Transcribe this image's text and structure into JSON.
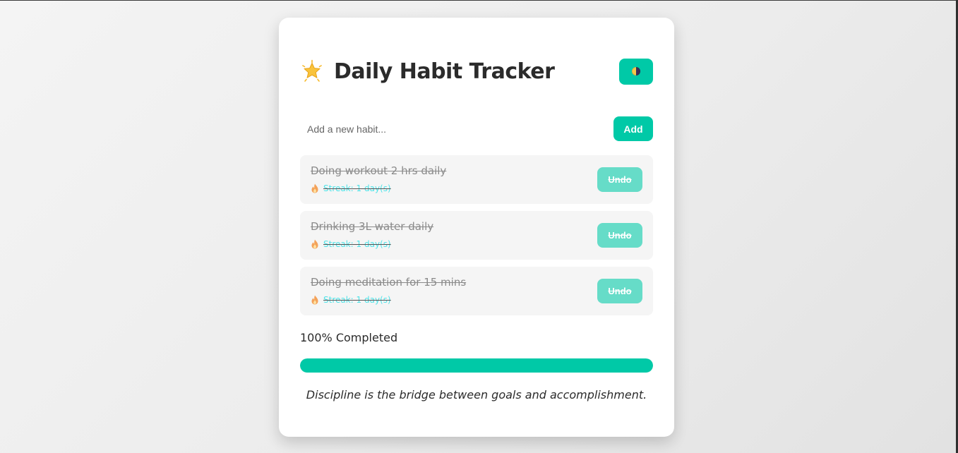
{
  "app": {
    "title": "Daily Habit Tracker",
    "title_icon": "glowing-star-icon",
    "theme_toggle_icon": "half-moon-contrast-icon"
  },
  "add_form": {
    "placeholder": "Add a new habit...",
    "value": "",
    "add_label": "Add"
  },
  "habits": [
    {
      "name": "Doing workout 2 hrs daily",
      "streak": "Streak: 1 day(s)",
      "action_label": "Undo",
      "completed": true
    },
    {
      "name": "Drinking 3L water daily",
      "streak": "Streak: 1 day(s)",
      "action_label": "Undo",
      "completed": true
    },
    {
      "name": "Doing meditation for 15 mins",
      "streak": "Streak: 1 day(s)",
      "action_label": "Undo",
      "completed": true
    }
  ],
  "progress": {
    "label": "100% Completed",
    "percent": 100
  },
  "quote": "Discipline is the bridge between goals and accomplishment.",
  "colors": {
    "accent": "#00c9a7",
    "accent_muted": "#66dcc8",
    "streak_text": "#4fe3e8",
    "completed_text": "#8a8a8a"
  }
}
